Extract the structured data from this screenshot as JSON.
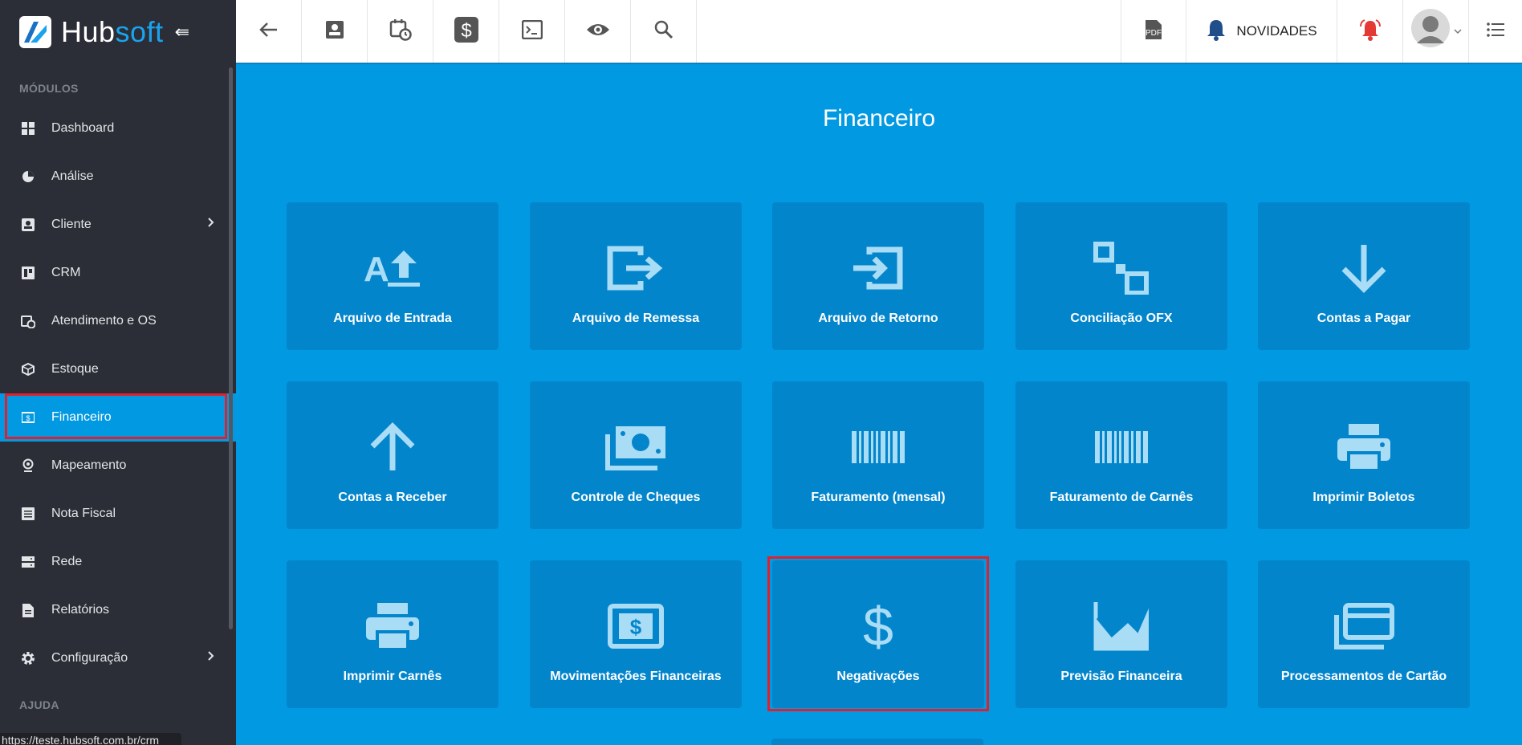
{
  "brand": {
    "hub": "Hub",
    "soft": "soft"
  },
  "sidebar": {
    "modules_label": "MÓDULOS",
    "help_label": "AJUDA",
    "items": [
      {
        "label": "Dashboard",
        "icon": "dashboard-icon"
      },
      {
        "label": "Análise",
        "icon": "pie-chart-icon"
      },
      {
        "label": "Cliente",
        "icon": "contact-card-icon",
        "has_submenu": true
      },
      {
        "label": "CRM",
        "icon": "board-icon"
      },
      {
        "label": "Atendimento e OS",
        "icon": "calendar-clock-icon"
      },
      {
        "label": "Estoque",
        "icon": "box-icon"
      },
      {
        "label": "Financeiro",
        "icon": "money-icon",
        "active": true
      },
      {
        "label": "Mapeamento",
        "icon": "map-pin-icon"
      },
      {
        "label": "Nota Fiscal",
        "icon": "document-list-icon"
      },
      {
        "label": "Rede",
        "icon": "server-icon"
      },
      {
        "label": "Relatórios",
        "icon": "report-icon"
      },
      {
        "label": "Configuração",
        "icon": "gear-icon",
        "has_submenu": true
      }
    ]
  },
  "status_url": "https://teste.hubsoft.com.br/crm",
  "topbar": {
    "novidades": "NOVIDADES"
  },
  "main": {
    "title": "Financeiro",
    "tiles": [
      {
        "label": "Arquivo de Entrada",
        "icon": "text-upload-icon"
      },
      {
        "label": "Arquivo de Remessa",
        "icon": "export-icon"
      },
      {
        "label": "Arquivo de Retorno",
        "icon": "import-icon"
      },
      {
        "label": "Conciliação OFX",
        "icon": "squares-icon"
      },
      {
        "label": "Contas a Pagar",
        "icon": "arrow-down-icon"
      },
      {
        "label": "Contas a Receber",
        "icon": "arrow-up-icon"
      },
      {
        "label": "Controle de Cheques",
        "icon": "cash-stack-icon"
      },
      {
        "label": "Faturamento (mensal)",
        "icon": "barcode-icon"
      },
      {
        "label": "Faturamento de Carnês",
        "icon": "barcode-icon"
      },
      {
        "label": "Imprimir Boletos",
        "icon": "printer-icon"
      },
      {
        "label": "Imprimir Carnês",
        "icon": "printer-icon"
      },
      {
        "label": "Movimentações Financeiras",
        "icon": "money-box-icon"
      },
      {
        "label": "Negativações",
        "icon": "dollar-icon"
      },
      {
        "label": "Previsão Financeira",
        "icon": "area-chart-icon"
      },
      {
        "label": "Processamentos de Cartão",
        "icon": "credit-cards-icon"
      }
    ]
  }
}
